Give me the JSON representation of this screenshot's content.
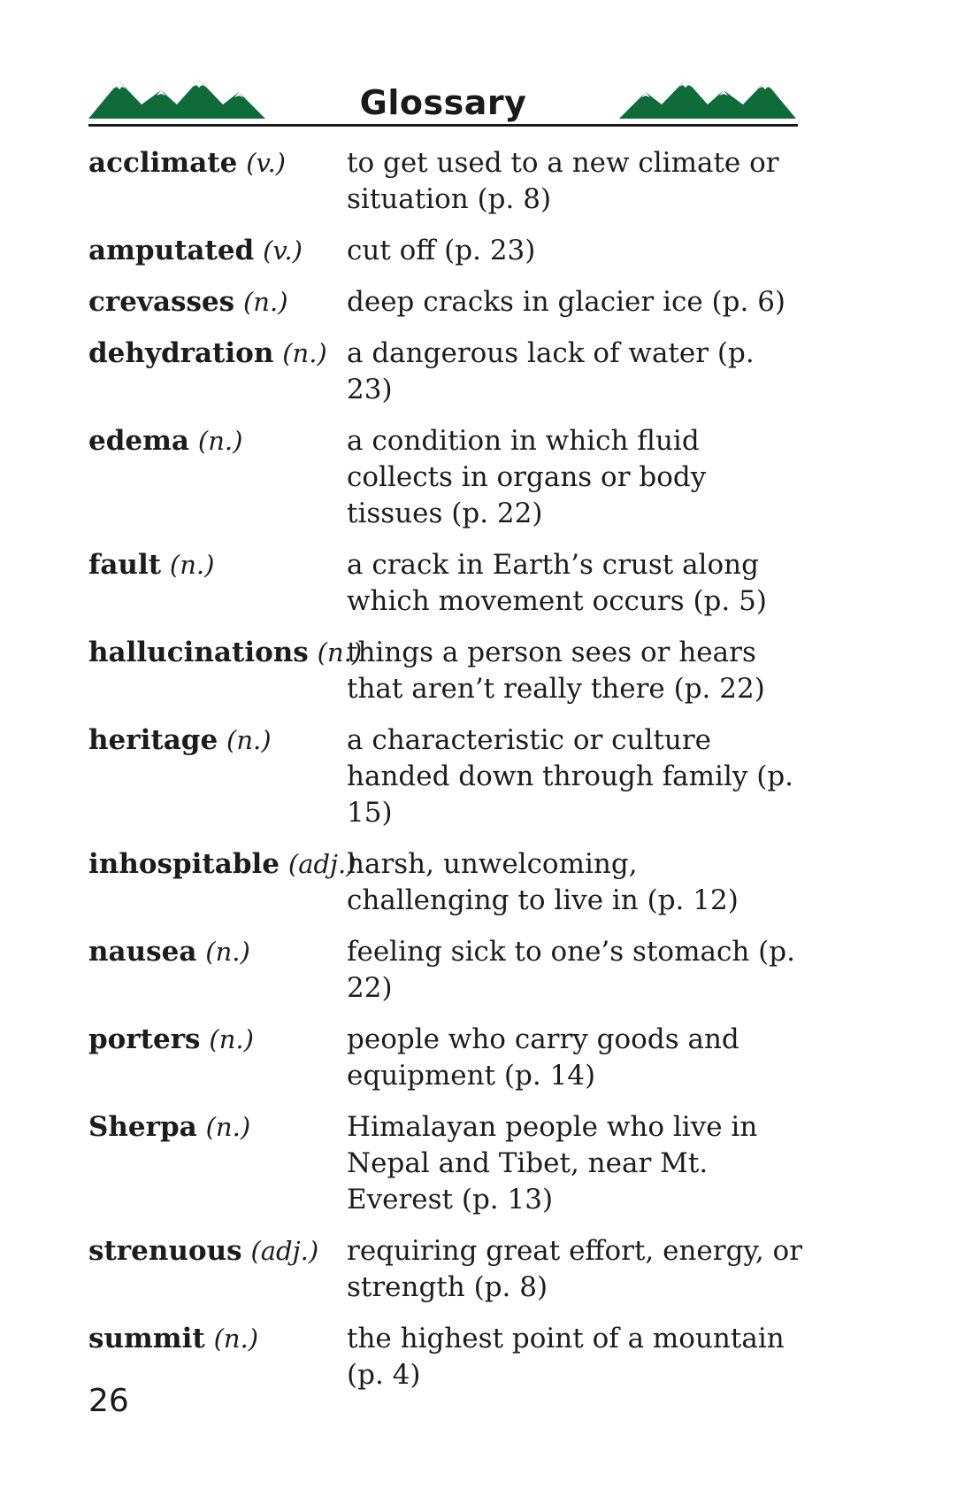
{
  "header": {
    "title": "Glossary",
    "mountain_color": "#0f6b3a",
    "left_icon": "mountain-range-icon",
    "right_icon": "mountain-range-icon"
  },
  "entries": [
    {
      "term": "acclimate",
      "pos": "(v.)",
      "definition": "to get used to a new climate or situation (p. 8)"
    },
    {
      "term": "amputated",
      "pos": "(v.)",
      "definition": "cut off (p. 23)"
    },
    {
      "term": "crevasses",
      "pos": "(n.)",
      "definition": "deep cracks in glacier ice (p. 6)"
    },
    {
      "term": "dehydration",
      "pos": "(n.)",
      "definition": "a dangerous lack of water (p. 23)"
    },
    {
      "term": "edema",
      "pos": "(n.)",
      "definition": "a condition in which fluid collects in organs or body tissues (p. 22)"
    },
    {
      "term": "fault",
      "pos": "(n.)",
      "definition": "a crack in Earth’s crust along which movement occurs (p. 5)"
    },
    {
      "term": "hallucinations",
      "pos": "(n.)",
      "definition": "things a person sees or hears that aren’t really there (p. 22)"
    },
    {
      "term": "heritage",
      "pos": "(n.)",
      "definition": "a characteristic or culture handed down through family (p. 15)"
    },
    {
      "term": "inhospitable",
      "pos": "(adj.)",
      "definition": "harsh, unwelcoming, challenging to live in (p. 12)"
    },
    {
      "term": "nausea",
      "pos": "(n.)",
      "definition": "feeling sick to one’s stomach (p. 22)"
    },
    {
      "term": "porters",
      "pos": "(n.)",
      "definition": "people who carry goods and equipment (p. 14)"
    },
    {
      "term": "Sherpa",
      "pos": "(n.)",
      "definition": "Himalayan people who live in Nepal and Tibet, near Mt. Everest (p. 13)"
    },
    {
      "term": "strenuous",
      "pos": "(adj.)",
      "definition": "requiring great effort, energy, or strength (p. 8)"
    },
    {
      "term": "summit",
      "pos": "(n.)",
      "definition": "the highest point of a mountain (p. 4)"
    }
  ],
  "footer": {
    "page_number": "26"
  }
}
